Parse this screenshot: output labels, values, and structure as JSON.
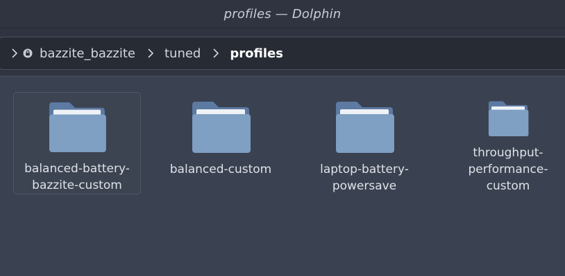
{
  "window": {
    "title": "profiles — Dolphin"
  },
  "breadcrumb": {
    "segments": [
      {
        "label": "bazzite_bazzite",
        "icon": "lock-icon"
      },
      {
        "label": "tuned"
      },
      {
        "label": "profiles",
        "current": true
      }
    ]
  },
  "files": [
    {
      "name": "balanced-battery-\nbazzite-custom",
      "type": "folder",
      "selected": true
    },
    {
      "name": "balanced-custom",
      "type": "folder"
    },
    {
      "name": "laptop-battery-\npowersave",
      "type": "folder"
    },
    {
      "name": "throughput-\nperformance-\ncustom",
      "type": "folder"
    }
  ],
  "colors": {
    "background": "#3a4150",
    "titlebar": "#2f3440",
    "folder_body": "#7f9fc3",
    "folder_back": "#5c7aa2",
    "paper": "#eef2f6"
  }
}
